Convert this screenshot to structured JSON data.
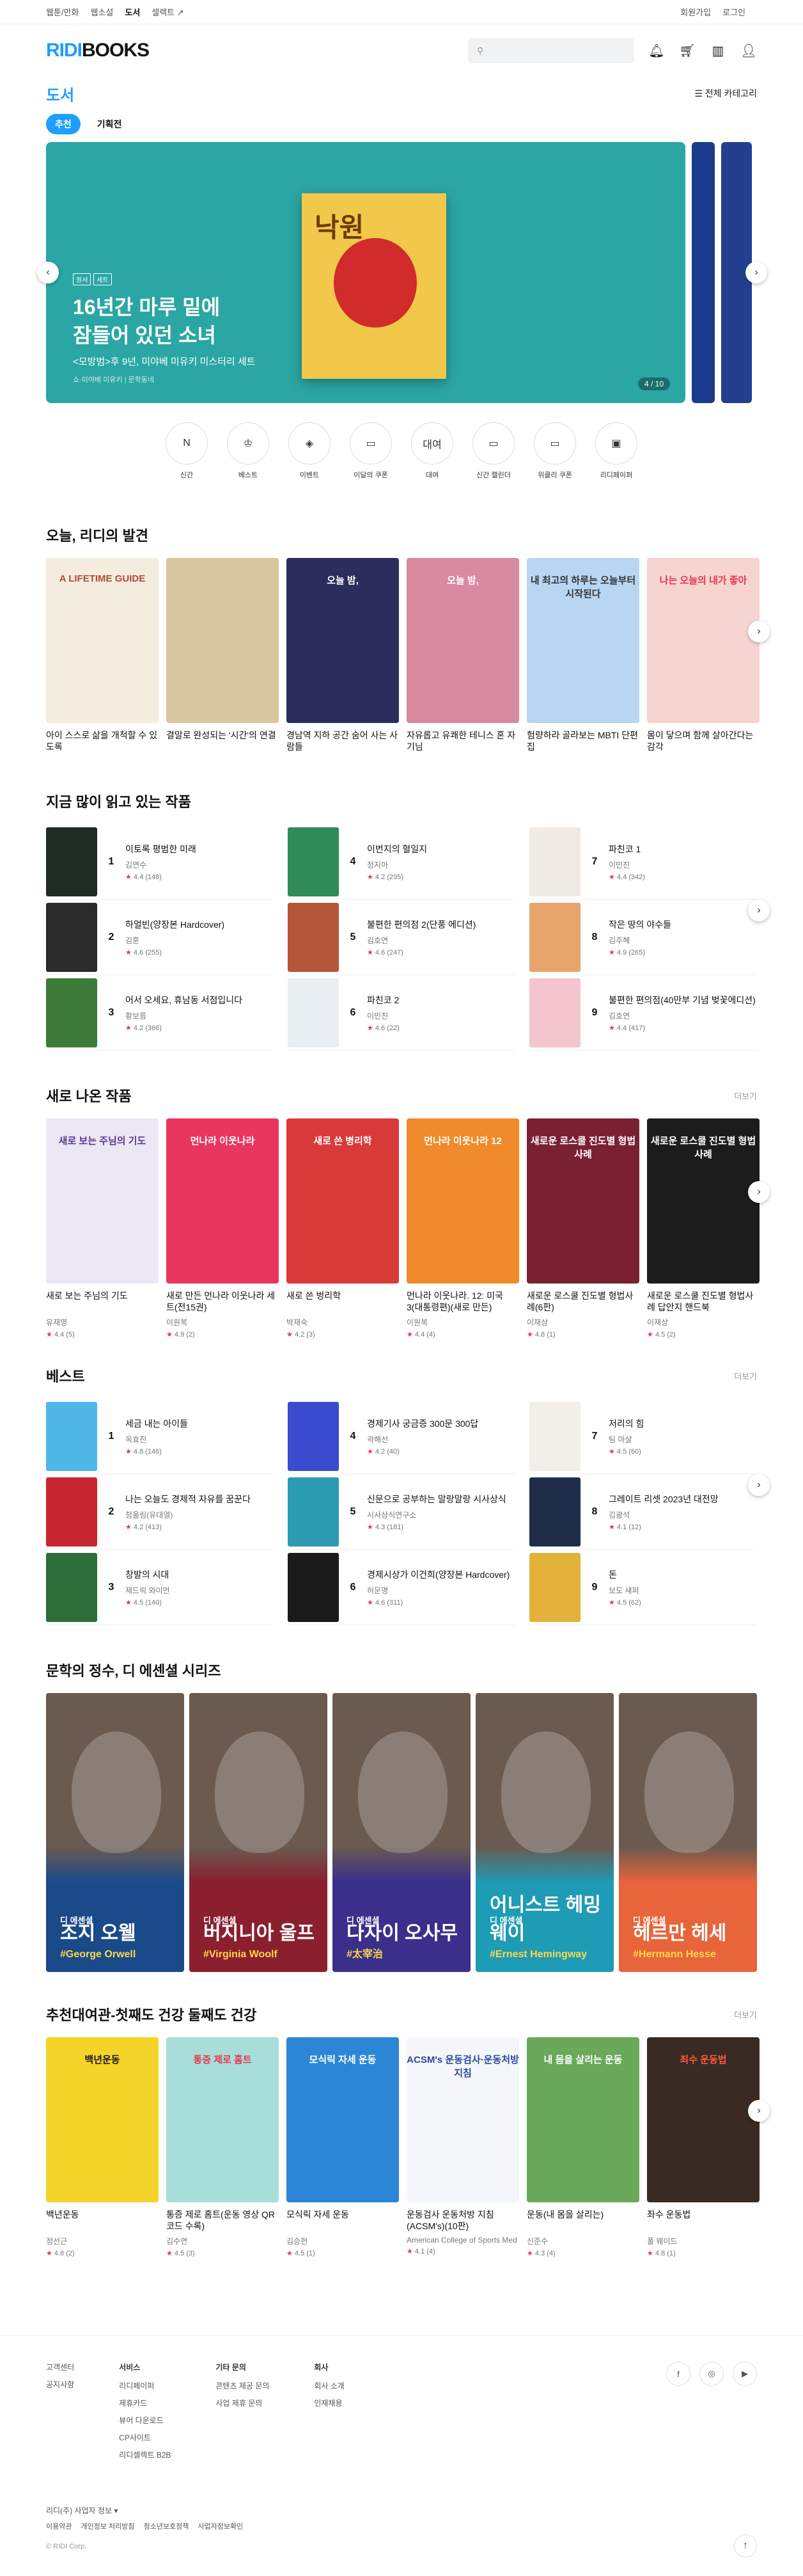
{
  "topbar": {
    "left": [
      "웹툰/만화",
      "웹소설",
      "도서",
      "셀렉트 ↗"
    ],
    "right": [
      "회원가입",
      "로그인"
    ]
  },
  "header": {
    "logo_a": "RIDI",
    "logo_b": "BOOKS",
    "search_placeholder": ""
  },
  "category": {
    "title": "도서",
    "menu": "전체 카테고리"
  },
  "tabs": [
    "추천",
    "기획전"
  ],
  "banner": {
    "tags": [
      "원서",
      "세트"
    ],
    "title1": "16년간 마루 밑에",
    "title2": "잠들어 있던 소녀",
    "sub": "<모방범>후 9년, 미야베 미유키 미스터리 세트",
    "note": "쇼·미야베 미유키 | 문학동네",
    "counter": "4 / 10",
    "book_title": "낙원"
  },
  "quick": [
    "신간",
    "베스트",
    "이벤트",
    "이달의 쿠폰",
    "대여",
    "신간 캘린더",
    "위클리 쿠폰",
    "리디페이퍼"
  ],
  "quick_icons": [
    "N",
    "♔",
    "◈",
    "▭",
    "대여",
    "▭",
    "▭",
    "▣"
  ],
  "sec1": {
    "title": "오늘, 리디의 발견",
    "books": [
      {
        "title": "아이 스스로 삶을 개척할 수 있도록",
        "cover": "A LIFETIME GUIDE",
        "color": "#f4ecdf",
        "text": "#b04a3a"
      },
      {
        "title": "결말로 완성되는 '시간'의 연결",
        "cover": "",
        "color": "#d9c7a0",
        "text": "#333"
      },
      {
        "title": "경남역 지하 공간 숨어 사는 사람들",
        "cover": "오늘 밤,",
        "color": "#2b2e5c",
        "text": "#fff"
      },
      {
        "title": "자유롭고 유쾌한 테니스 혼 자기님",
        "cover": "오늘 밤,",
        "color": "#d88aa0",
        "text": "#fff"
      },
      {
        "title": "험량하라 골라보는 MBTI 단편집",
        "cover": "내 최고의 하루는 오늘부터 시작된다",
        "color": "#b8d6f2",
        "text": "#333"
      },
      {
        "title": "몸이 닿으며 함께 살아간다는 감각",
        "cover": "나는 오늘의 내가 좋아",
        "color": "#f6d4cf",
        "text": "#e8364e"
      }
    ]
  },
  "sec2": {
    "title": "지금 많이 읽고 있는 작품",
    "items": [
      {
        "rank": "1",
        "title": "이토록 평범한 미래",
        "author": "김연수",
        "rating": "4.4 (148)",
        "color": "#1d2b24"
      },
      {
        "rank": "2",
        "title": "하얼빈(양장본 Hardcover)",
        "author": "김훈",
        "rating": "4.6 (255)",
        "color": "#2a2a2a"
      },
      {
        "rank": "3",
        "title": "어서 오세요, 휴남동 서점입니다",
        "author": "황보름",
        "rating": "4.2 (366)",
        "color": "#3c7a3a"
      },
      {
        "rank": "4",
        "title": "이번지의 혈일지",
        "author": "정지아",
        "rating": "4.2 (295)",
        "color": "#2e8b57"
      },
      {
        "rank": "5",
        "title": "불편한 편의점 2(단풍 에디션)",
        "author": "김호연",
        "rating": "4.6 (247)",
        "color": "#b5553a"
      },
      {
        "rank": "6",
        "title": "파친코 2",
        "author": "이민진",
        "rating": "4.6 (22)",
        "color": "#e9eef2"
      },
      {
        "rank": "7",
        "title": "파친코 1",
        "author": "이민진",
        "rating": "4.4 (342)",
        "color": "#f0ece4"
      },
      {
        "rank": "8",
        "title": "작은 땅의 야수들",
        "author": "김주혜",
        "rating": "4.9 (265)",
        "color": "#e6a46a"
      },
      {
        "rank": "9",
        "title": "불편한 편의점(40만부 기념 벚꽃에디션)",
        "author": "김호연",
        "rating": "4.4 (417)",
        "color": "#f3c5cf"
      }
    ]
  },
  "sec3": {
    "title": "새로 나온 작품",
    "more": "더보기",
    "books": [
      {
        "title": "새로 보는 주님의 기도",
        "author": "유재영",
        "rating": "4.4 (5)",
        "cover": "새로 보는 주님의 기도",
        "color": "#ece7f4",
        "text": "#5a3a8a"
      },
      {
        "title": "새로 만든 먼나라 이웃나라 세트(전15권)",
        "author": "이원복",
        "rating": "4.9 (2)",
        "cover": "먼나라 이웃나라",
        "color": "#e8365e",
        "text": "#fff"
      },
      {
        "title": "새로 쓴 벙리학",
        "author": "박재숙",
        "rating": "4.2 (3)",
        "cover": "새로 쓴 병리학",
        "color": "#d83a3a",
        "text": "#fff"
      },
      {
        "title": "먼나라 이웃나라. 12: 미국3(대통령편)(새로 만든)",
        "author": "이원복",
        "rating": "4.4 (4)",
        "cover": "먼나라 이웃나라 12",
        "color": "#f08a2a",
        "text": "#fff"
      },
      {
        "title": "새로운 로스쿨 진도별 형법사례(6판)",
        "author": "이재상",
        "rating": "4.8 (1)",
        "cover": "새로운 로스쿨 진도별 형법사례",
        "color": "#7a2033",
        "text": "#fff"
      },
      {
        "title": "새로운 로스쿨 진도별 형법사례 답안지 핸드북",
        "author": "이재상",
        "rating": "4.5 (2)",
        "cover": "새로운 로스쿨 진도별 형법사례",
        "color": "#1c1c1c",
        "text": "#fff"
      }
    ]
  },
  "sec4": {
    "title": "베스트",
    "more": "더보기",
    "items": [
      {
        "rank": "1",
        "title": "세금 내는 아이들",
        "author": "옥효진",
        "rating": "4.8 (146)",
        "color": "#4fb7e8"
      },
      {
        "rank": "2",
        "title": "나는 오늘도 경제적 자유를 꿈꾼다",
        "author": "청울림(유대열)",
        "rating": "4.2 (413)",
        "color": "#c8262f"
      },
      {
        "rank": "3",
        "title": "창발의 시대",
        "author": "제드릭 와이먼",
        "rating": "4.5 (140)",
        "color": "#2c6e3a"
      },
      {
        "rank": "4",
        "title": "경제기사 궁금증 300문 300답",
        "author": "곽해선",
        "rating": "4.2 (40)",
        "color": "#3a4bd0"
      },
      {
        "rank": "5",
        "title": "신문으로 공부하는 말랑말랑 시사상식",
        "author": "시사상식연구소",
        "rating": "4.3 (181)",
        "color": "#2a9bb0"
      },
      {
        "rank": "6",
        "title": "경제시상가 이건희(양장본 Hardcover)",
        "author": "허문명",
        "rating": "4.6 (311)",
        "color": "#1a1a1a"
      },
      {
        "rank": "7",
        "title": "저리의 힘",
        "author": "팀 마샬",
        "rating": "4.5 (60)",
        "color": "#f2efe8"
      },
      {
        "rank": "8",
        "title": "그레이트 리셋 2023년 대전망",
        "author": "김광석",
        "rating": "4.1 (12)",
        "color": "#1f2d4a"
      },
      {
        "rank": "9",
        "title": "돈",
        "author": "보도 섀퍼",
        "rating": "4.5 (62)",
        "color": "#e3b23a"
      }
    ]
  },
  "sec5": {
    "title": "문학의 정수, 디 에센셜 시리즈",
    "items": [
      {
        "label": "디 에센셜",
        "name": "조지 오웰",
        "en": "#George Orwell",
        "color": "#1a4a8a"
      },
      {
        "label": "디 에센셜",
        "name": "버지니아 울프",
        "en": "#Virginia Woolf",
        "color": "#8a1f2e"
      },
      {
        "label": "디 에센셜",
        "name": "다자이 오사무",
        "en": "#太宰治",
        "color": "#3a2f8a"
      },
      {
        "label": "디 에센셜",
        "name": "어니스트 헤밍웨이",
        "en": "#Ernest Hemingway",
        "color": "#1e9bb5"
      },
      {
        "label": "디 에센셜",
        "name": "헤르만 헤세",
        "en": "#Hermann Hesse",
        "color": "#e8643a"
      }
    ]
  },
  "sec6": {
    "title": "추천대여관-첫째도 건강 둘째도 건강",
    "more": "더보기",
    "books": [
      {
        "title": "백년운동",
        "author": "정선근",
        "rating": "4.8 (2)",
        "cover": "백년운동",
        "color": "#f5d42a",
        "text": "#1a1a1a"
      },
      {
        "title": "통증 제로 홈트(운동 영상 QR코드 수록)",
        "author": "김수연",
        "rating": "4.5 (3)",
        "cover": "통증 제로 홈트",
        "color": "#a8ded9",
        "text": "#e8364e"
      },
      {
        "title": "모식릭 자세 운동",
        "author": "김승현",
        "rating": "4.5 (1)",
        "cover": "모식릭 자세 운동",
        "color": "#2b86d6",
        "text": "#fff"
      },
      {
        "title": "운동검사 운동처방 지침(ACSM's)(10판)",
        "author": "American College of Sports Med",
        "rating": "4.1 (4)",
        "cover": "ACSM's 운동검사·운동처방 지침",
        "color": "#f4f6fa",
        "text": "#2a4a9a"
      },
      {
        "title": "운동(내 몸을 살리는)",
        "author": "신준수",
        "rating": "4.3 (4)",
        "cover": "내 몸을 살리는 운동",
        "color": "#6aa85a",
        "text": "#fff"
      },
      {
        "title": "좌수 운동법",
        "author": "폴 웨이드",
        "rating": "4.8 (1)",
        "cover": "죄수 운동법",
        "color": "#3a2a24",
        "text": "#ff5a3a"
      }
    ]
  },
  "footer": {
    "cols": [
      {
        "h": "",
        "items": [
          "고객센터",
          "공지사항"
        ]
      },
      {
        "h": "서비스",
        "items": [
          "리디페이퍼",
          "제휴카드",
          "뷰어 다운로드",
          "CP사이트",
          "리디셀렉트 B2B"
        ]
      },
      {
        "h": "기타 문의",
        "items": [
          "콘텐츠 제공 문의",
          "사업 제휴 문의"
        ]
      },
      {
        "h": "회사",
        "items": [
          "회사 소개",
          "인재채용"
        ]
      }
    ],
    "social": [
      "f",
      "◎",
      "▶"
    ],
    "biz": "리디(주) 사업자 정보 ▾",
    "links": [
      "이용약관",
      "개인정보 처리방침",
      "청소년보호정책",
      "사업자정보확인"
    ],
    "copy": "© RIDI Corp."
  }
}
